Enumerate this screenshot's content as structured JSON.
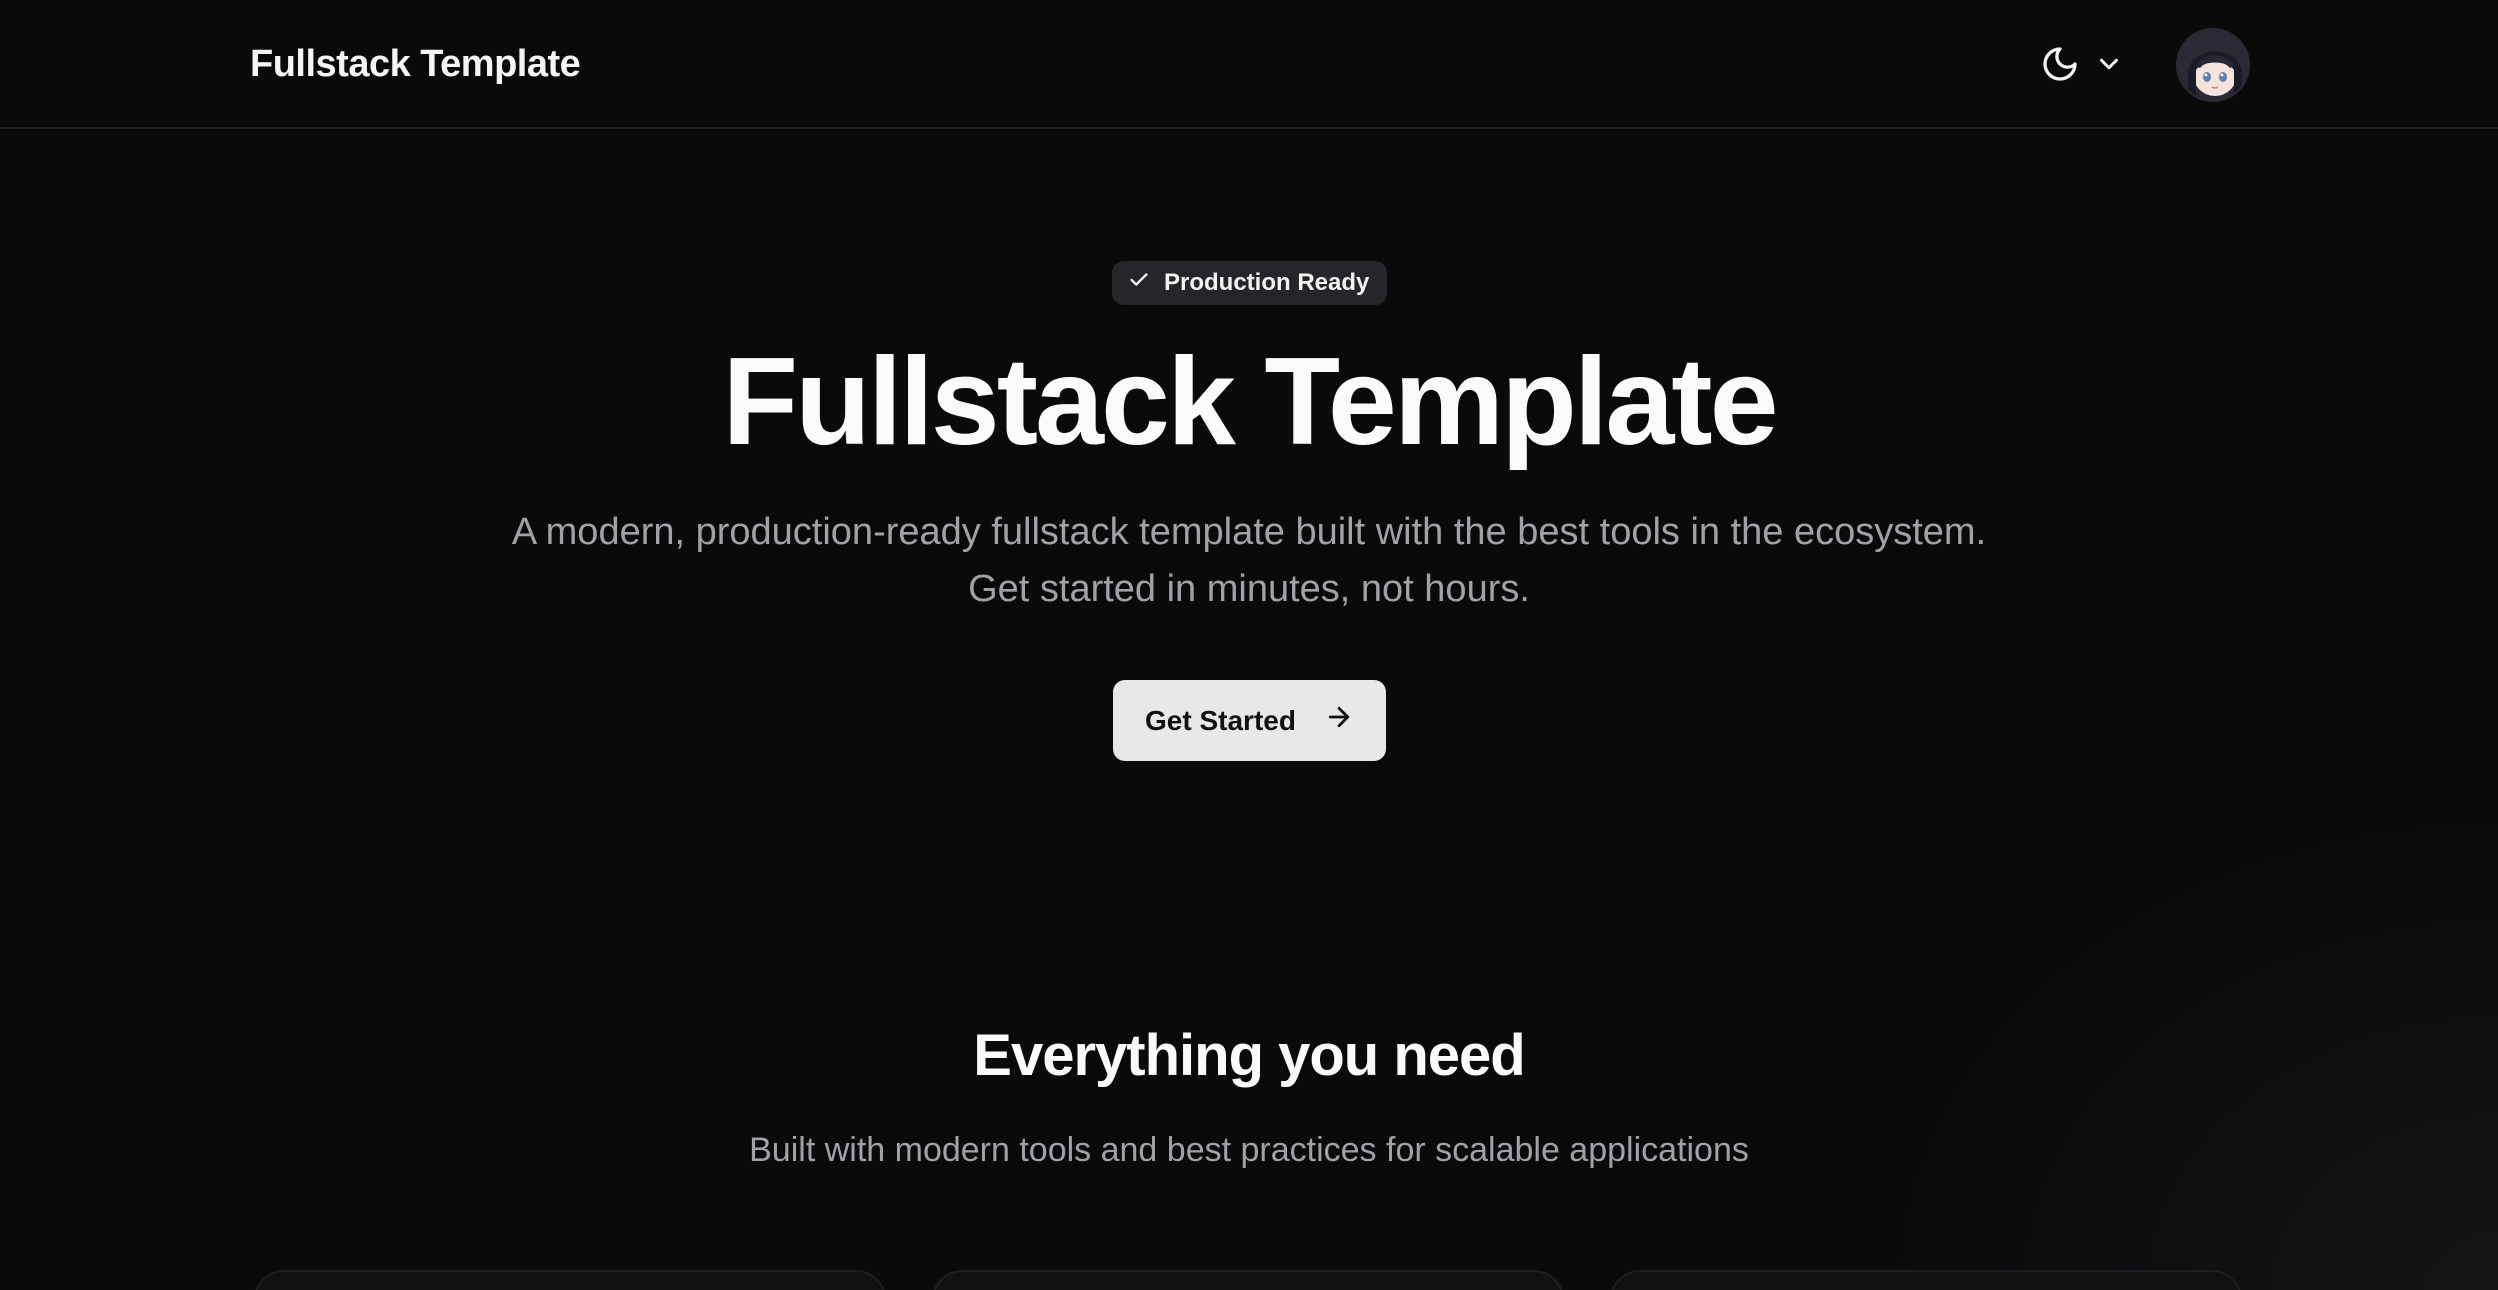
{
  "header": {
    "brand": "Fullstack Template",
    "theme_icon": "moon-icon",
    "theme_dropdown_icon": "chevron-down-icon",
    "avatar_alt": "user-avatar"
  },
  "hero": {
    "badge": {
      "icon": "check-icon",
      "label": "Production Ready"
    },
    "title": "Fullstack Template",
    "subtitle_line1": "A modern, production-ready fullstack template built with the best tools in the ecosystem.",
    "subtitle_line2": "Get started in minutes, not hours.",
    "cta": {
      "label": "Get Started",
      "icon": "arrow-right-icon"
    }
  },
  "features": {
    "title": "Everything you need",
    "subtitle": "Built with modern tools and best practices for scalable applications"
  },
  "colors": {
    "background": "#0a0a0b",
    "text_primary": "#fafafa",
    "text_muted": "#a1a1a8",
    "badge_bg": "#26262a",
    "cta_bg": "#e8e8e8",
    "cta_text": "#111113"
  }
}
